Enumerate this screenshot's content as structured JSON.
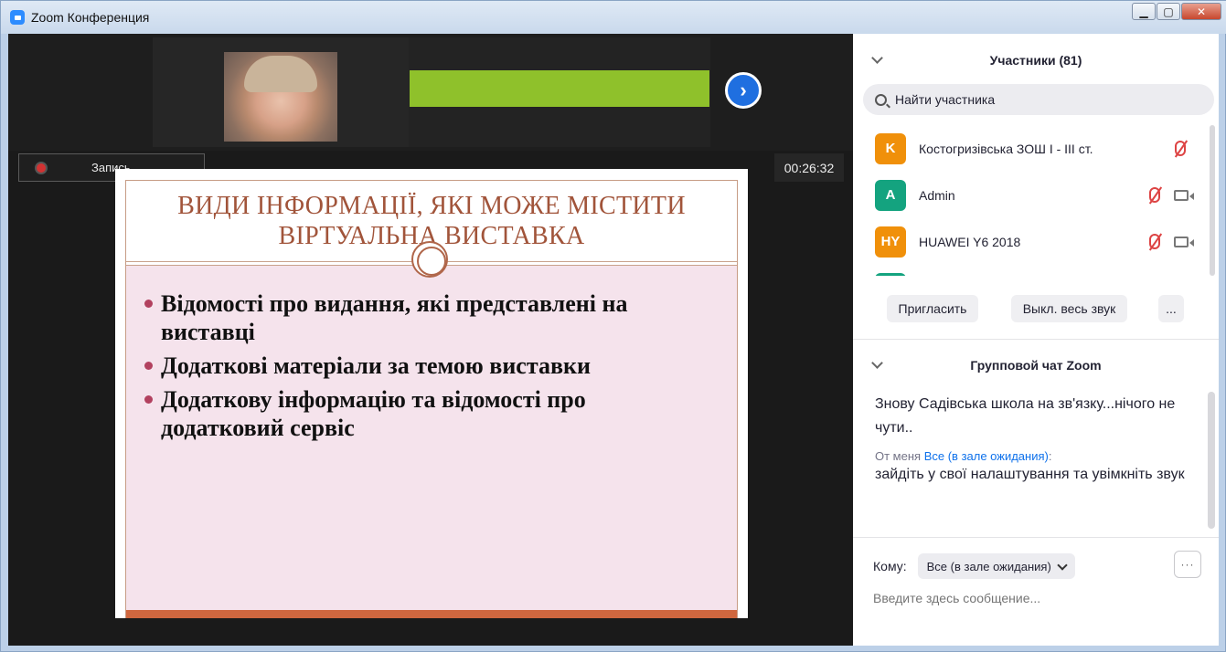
{
  "window": {
    "title": "Zoom Конференция",
    "minimize": "▁",
    "maximize": "▢",
    "close": "✕"
  },
  "recording": {
    "label": "Запись..."
  },
  "timer": "00:26:32",
  "next_arrow": "›",
  "slide": {
    "title_line1": "ВИДИ ІНФОРМАЦІЇ, ЯКІ МОЖЕ МІСТИТИ",
    "title_line2": "ВІРТУАЛЬНА ВИСТАВКА",
    "bullets": [
      "Відомості про видання, які представлені на виставці",
      "Додаткові матеріали за темою виставки",
      "Додаткову інформацію та відомості про додатковий сервіс"
    ]
  },
  "participants": {
    "header": "Участники (81)",
    "search_placeholder": "Найти участника",
    "items": [
      {
        "initials": "K",
        "name": "Костогризівська ЗОШ І - ІІІ ст.",
        "color": "#f0900a"
      },
      {
        "initials": "A",
        "name": "Admin",
        "color": "#14a37f"
      },
      {
        "initials": "HY",
        "name": "HUAWEI Y6 2018",
        "color": "#f0900a"
      }
    ],
    "invite_label": "Пригласить",
    "mute_all_label": "Выкл. весь звук",
    "more_label": "..."
  },
  "chat": {
    "header": "Групповой чат Zoom",
    "messages": [
      {
        "text": "Знову Садівська школа на зв'язку...нічого не чути.."
      },
      {
        "from": "От меня",
        "to": "Все (в зале ожидания)",
        "colon": ":",
        "text": "зайдіть у свої налаштування та увімкніть звук"
      }
    ],
    "to_label": "Кому:",
    "to_value": "Все (в зале ожидания)",
    "more_label": "···",
    "input_placeholder": "Введите здесь сообщение..."
  }
}
